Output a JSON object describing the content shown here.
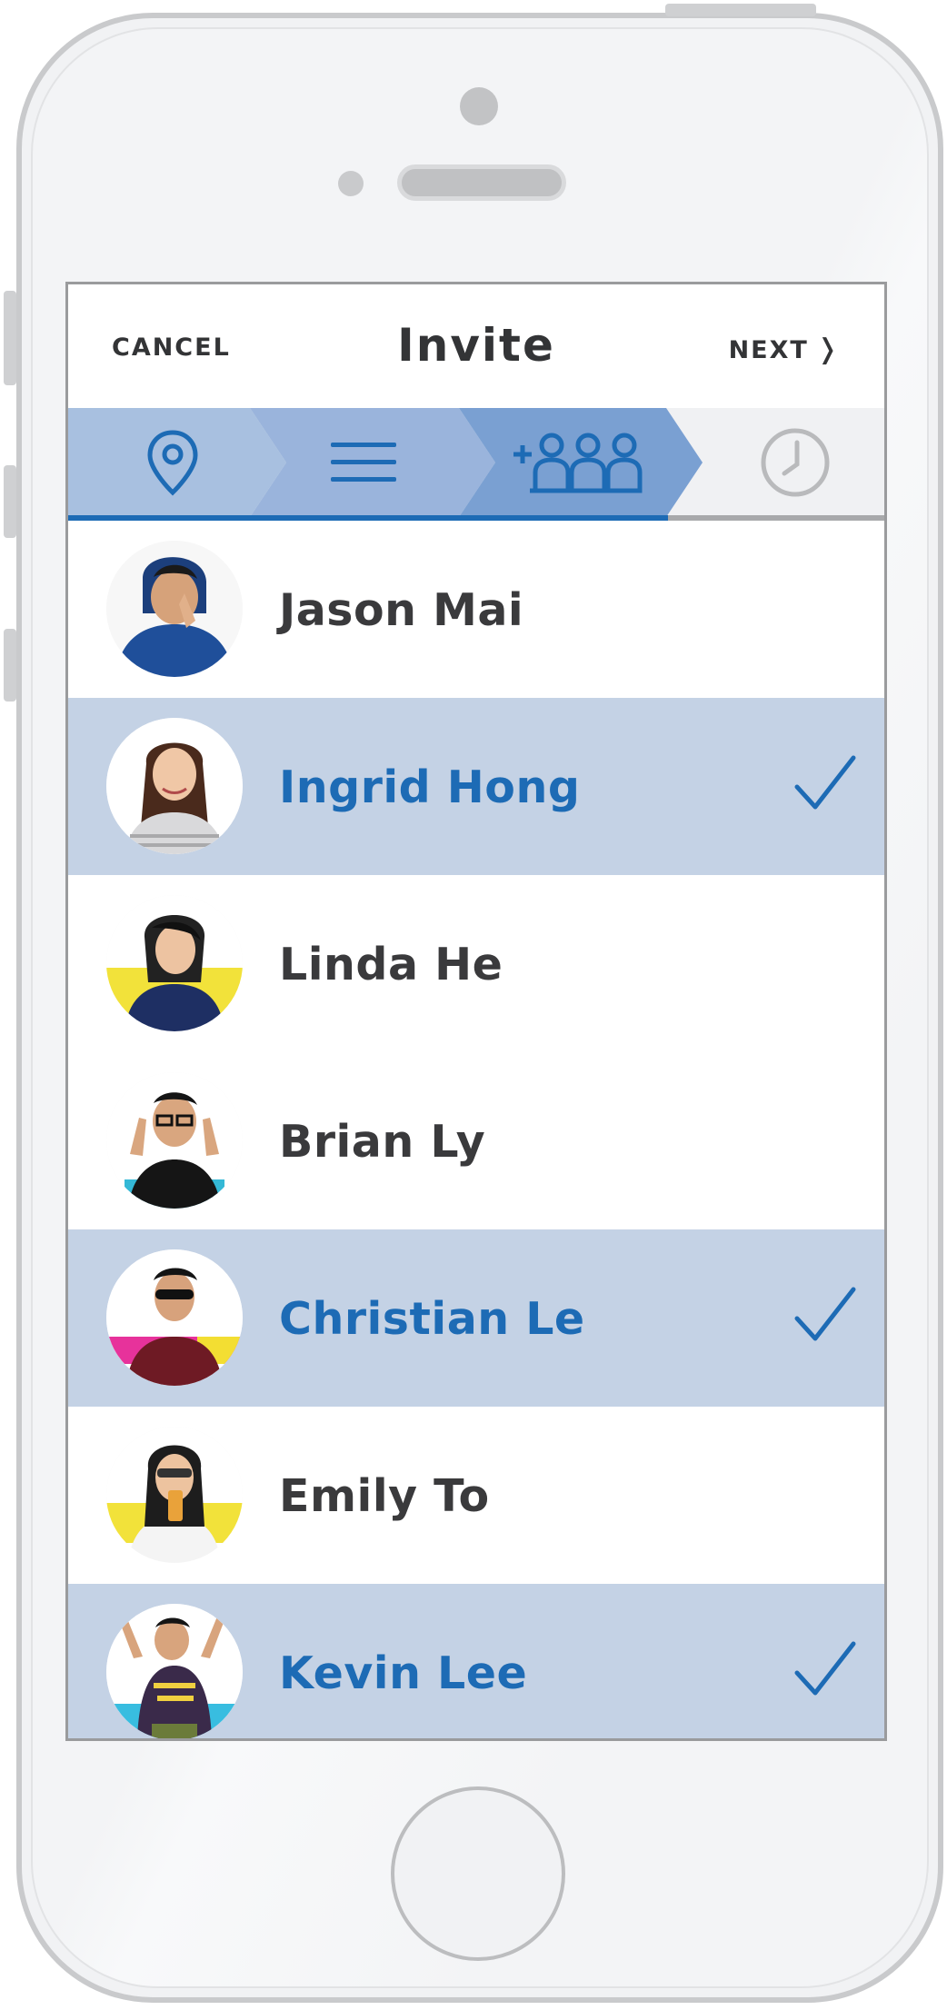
{
  "nav": {
    "cancel": "CANCEL",
    "title": "Invite",
    "next": "NEXT",
    "next_chevron": "❭"
  },
  "steps": [
    {
      "icon": "location-pin-icon",
      "state": "done"
    },
    {
      "icon": "details-list-icon",
      "state": "done"
    },
    {
      "icon": "add-people-icon",
      "state": "current"
    },
    {
      "icon": "clock-icon",
      "state": "pending"
    }
  ],
  "contacts": [
    {
      "name": "Jason Mai",
      "selected": false
    },
    {
      "name": "Ingrid Hong",
      "selected": true
    },
    {
      "name": "Linda He",
      "selected": false
    },
    {
      "name": "Brian Ly",
      "selected": false
    },
    {
      "name": "Christian Le",
      "selected": true
    },
    {
      "name": "Emily To",
      "selected": false
    },
    {
      "name": "Kevin Lee",
      "selected": true
    }
  ],
  "colors": {
    "accent": "#1d6bb5",
    "selected_row": "#c4d2e5",
    "step_done_1": "#a8c0e0",
    "step_done_2": "#9ab4dc",
    "step_current": "#7aa0d2",
    "step_pending": "#f0f1f3",
    "text": "#333436"
  }
}
